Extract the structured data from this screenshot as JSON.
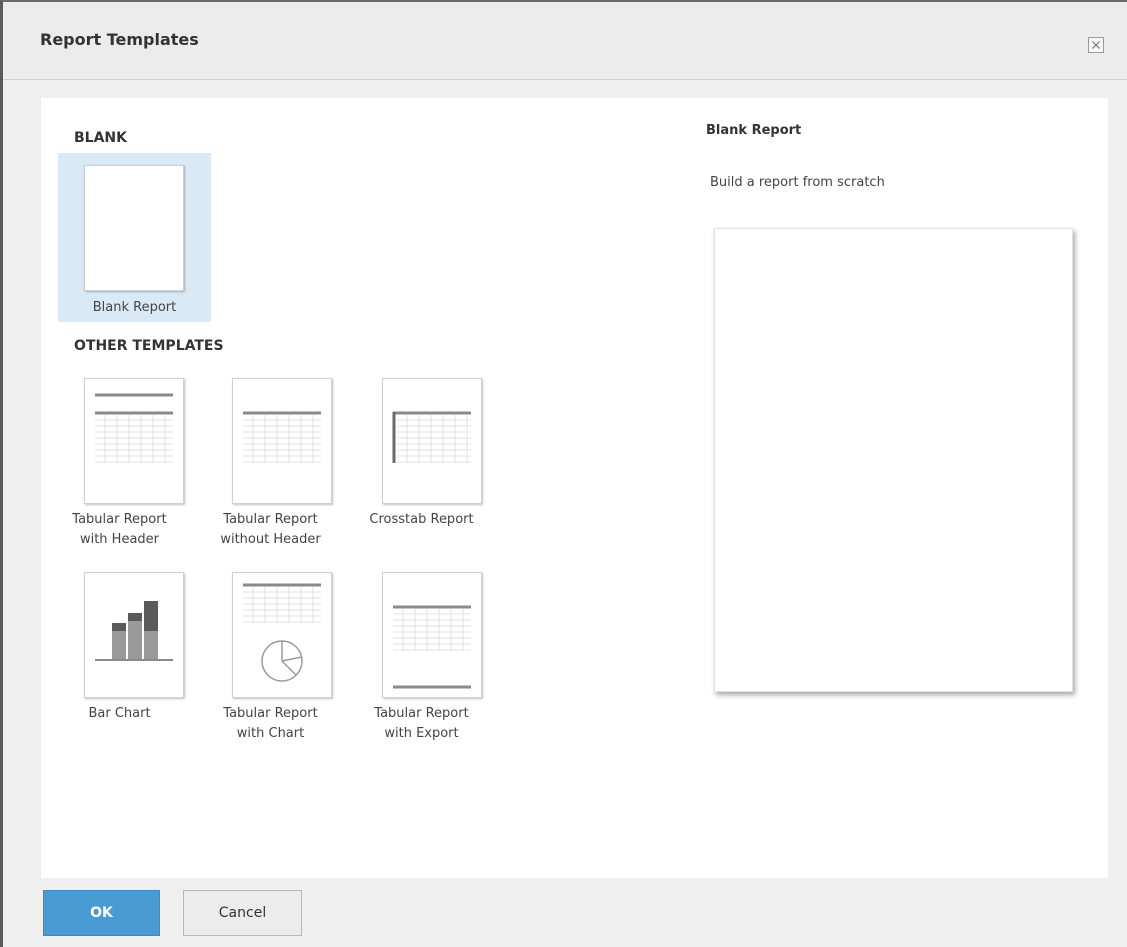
{
  "dialog": {
    "title": "Report Templates",
    "close_icon": "close-icon"
  },
  "sections": {
    "blank_heading": "BLANK",
    "other_heading": "OTHER TEMPLATES"
  },
  "templates": {
    "blank": {
      "line1": "Blank Report"
    },
    "tabular_header": {
      "line1": "Tabular Report",
      "line2": "with Header"
    },
    "tabular_no_header": {
      "line1": "Tabular Report",
      "line2": "without Header"
    },
    "crosstab": {
      "line1": "Crosstab Report"
    },
    "bar_chart": {
      "line1": "Bar Chart"
    },
    "tabular_chart": {
      "line1": "Tabular Report",
      "line2": "with Chart"
    },
    "tabular_export": {
      "line1": "Tabular Report",
      "line2": "with Export"
    }
  },
  "selected_template": "Blank Report",
  "preview": {
    "title": "Blank Report",
    "description": "Build a report from scratch"
  },
  "footer": {
    "ok_label": "OK",
    "cancel_label": "Cancel"
  },
  "colors": {
    "primary_button": "#4a9ad4",
    "selection": "#d9e9f6"
  }
}
